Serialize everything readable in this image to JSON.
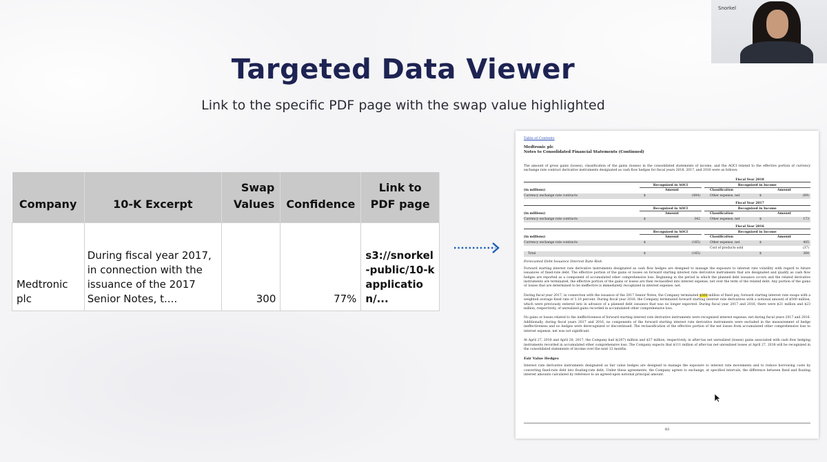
{
  "slide": {
    "title": "Targeted Data Viewer",
    "subtitle": "Link to the specific PDF page with the swap value highlighted"
  },
  "table": {
    "headers": [
      "Company",
      "10-K Excerpt",
      "Swap Values",
      "Confidence",
      "Link to PDF page"
    ],
    "row": {
      "company": "Medtronic plc",
      "excerpt": "During fiscal year 2017, in connection with the issuance of the 2017 Senior Notes, t....",
      "swap_value": "300",
      "confidence": "77%",
      "link": "s3://snorkel-public/10-kapplication/..."
    }
  },
  "arrow": {
    "color": "#1a5fb4"
  },
  "pdf": {
    "toc_link": "Table of Contents",
    "company": "Medtronic plc",
    "section": "Notes to Consolidated Financial Statements (Continued)",
    "intro": "The amount of gross gains (losses), classification of the gains (losses) in the consolidated statements of income, and the AOCI related to the effective portion of currency exchange rate contract derivative instruments designated as cash flow hedges for fiscal years 2018, 2017, and 2016 were as follows:",
    "col_aoci": "Recognized in AOCI",
    "col_income": "Recognized in Income",
    "col_amount": "Amount",
    "col_classification": "Classification",
    "in_millions": "(in millions)",
    "row_label": "Currency exchange rate contracts",
    "other_expense": "Other expense, net",
    "cost_products": "Cost of products sold",
    "total": "Total",
    "dollar": "$",
    "fy2018": {
      "label": "Fiscal Year 2018",
      "aoci": "(404)",
      "income": "(69)"
    },
    "fy2017": {
      "label": "Fiscal Year 2017",
      "aoci": "342",
      "income": "173"
    },
    "fy2016": {
      "label": "Fiscal Year 2016",
      "aoci": "(165)",
      "income": "405",
      "cost": "(37)",
      "total_aoci": "(165)",
      "total_income": "368"
    },
    "h_forecast": "Forecasted Debt Issuance Interest Rate Risk",
    "p_forecast": "Forward starting interest rate derivative instruments designated as cash flow hedges are designed to manage the exposure to interest rate volatility with regard to future issuances of fixed-rate debt. The effective portion of the gains or losses on forward starting interest rate derivative instruments that are designated and qualify as cash flow hedges are reported as a component of accumulated other comprehensive loss. Beginning in the period in which the planned debt issuance occurs and the related derivative instruments are terminated, the effective portion of the gains or losses are then reclassified into interest expense, net over the term of the related debt. Any portion of the gains or losses that are determined to be ineffective is immediately recognized in interest expense, net.",
    "p_swap_before": "During fiscal year 2017, in connection with the issuance of the 2017 Senior Notes, the Company terminated ",
    "p_swap_highlight": "$300",
    "p_swap_after": " million of fixed pay, forward starting interest rate swaps with a weighted average fixed rate of 3.10 percent. During fiscal year 2016, the Company terminated forward starting interest rate derivatives with a notional amount of $500 million, which were previously entered into in advance of a planned debt issuance that was no longer expected. During fiscal year 2017 and 2016, there were $21 million and $23 million, respectively, of unrealized gains recorded in accumulated other comprehensive loss.",
    "p_nogains": "No gains or losses related to the ineffectiveness of forward starting interest rate derivative instruments were recognized interest expense, net during fiscal years 2017 and 2016. Additionally, during fiscal years 2017 and 2016, no components of the forward starting interest rate derivative instruments were excluded in the measurement of hedge ineffectiveness and no hedges were derecognized or discontinued. The reclassification of the effective portion of the net losses from accumulated other comprehensive loss to interest expense, net was not significant.",
    "p_april": "At April 27, 2018 and April 28, 2017, the Company had $(207) million and $37 million, respectively, in after-tax net unrealized (losses) gains associated with cash flow hedging instruments recorded in accumulated other comprehensive loss. The Company expects that $111 million of after-tax net unrealized losses at April 27, 2018 will be recognized in the consolidated statements of income over the next 12 months.",
    "h_fair": "Fair Value Hedges",
    "p_fair": "Interest rate derivative instruments designated as fair value hedges are designed to manage the exposure to interest rate movements and to reduce borrowing costs by converting fixed-rate debt into floating-rate debt. Under these agreements, the Company agrees to exchange, at specified intervals, the difference between fixed and floating interest amounts calculated by reference to an agreed-upon notional principal amount.",
    "page_number": "83"
  },
  "webcam": {
    "name": "Snorkel"
  }
}
